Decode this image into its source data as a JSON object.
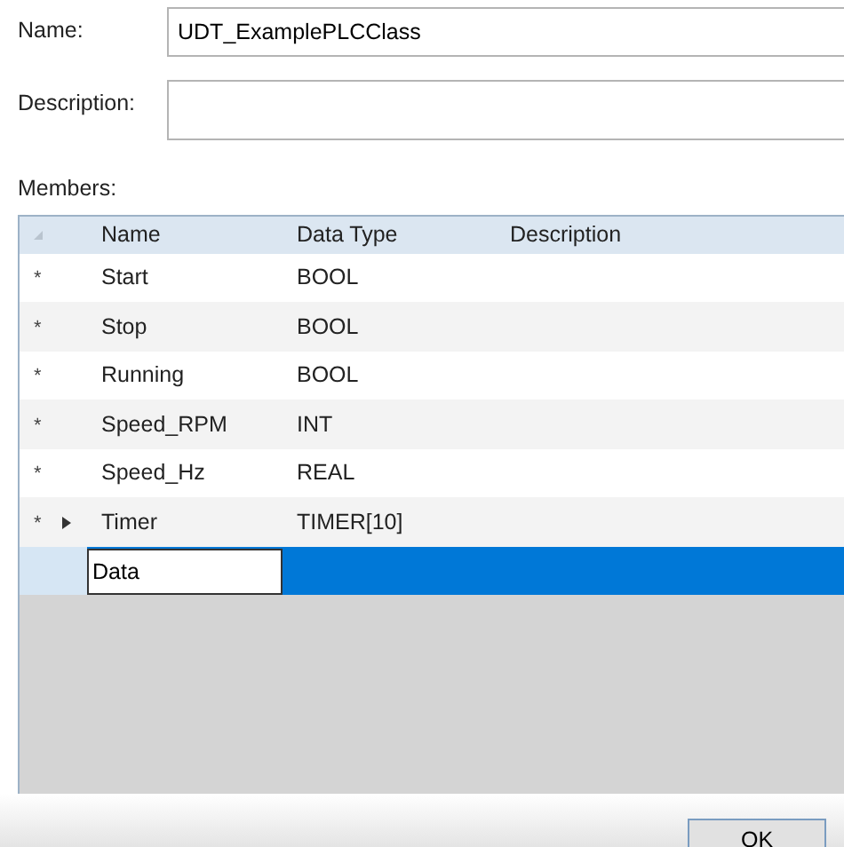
{
  "name_field": {
    "label": "Name:",
    "value": "UDT_ExamplePLCClass"
  },
  "description_field": {
    "label": "Description:"
  },
  "members": {
    "label": "Members:",
    "columns": [
      "Name",
      "Data Type",
      "Description"
    ],
    "rows": [
      {
        "marker": "*",
        "expandable": false,
        "name": "Start",
        "data_type": "BOOL",
        "selected": false,
        "kind": "member"
      },
      {
        "marker": "*",
        "expandable": false,
        "name": "Stop",
        "data_type": "BOOL",
        "selected": false,
        "kind": "member"
      },
      {
        "marker": "*",
        "expandable": false,
        "name": "Running",
        "data_type": "BOOL",
        "selected": false,
        "kind": "member"
      },
      {
        "marker": "*",
        "expandable": false,
        "name": "Speed_RPM",
        "data_type": "INT",
        "selected": false,
        "kind": "member"
      },
      {
        "marker": "*",
        "expandable": false,
        "name": "Speed_Hz",
        "data_type": "REAL",
        "selected": false,
        "kind": "member"
      },
      {
        "marker": "*",
        "expandable": true,
        "name": "Timer",
        "data_type": "TIMER[10]",
        "selected": false,
        "kind": "member"
      },
      {
        "name": "Data",
        "selected": true,
        "kind": "editing"
      }
    ]
  },
  "buttons": [
    "OK"
  ]
}
